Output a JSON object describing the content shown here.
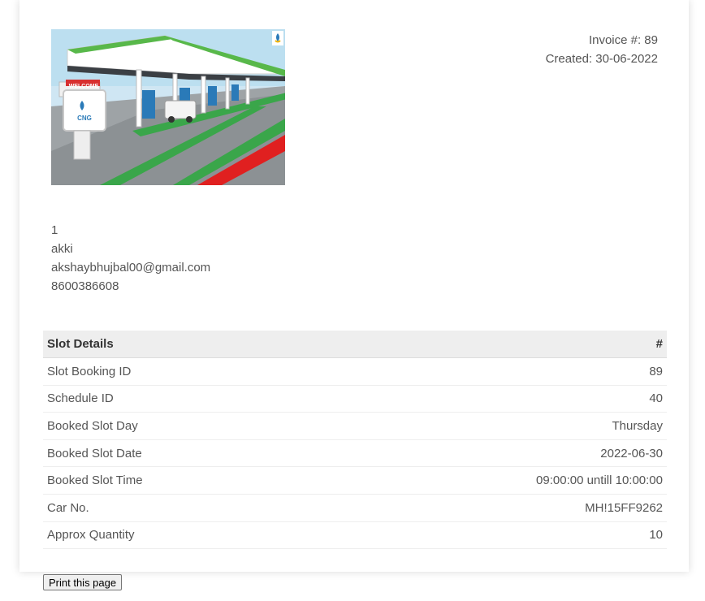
{
  "invoice": {
    "number_label": "Invoice #: 89",
    "created_label": "Created: 30-06-2022"
  },
  "logo": {
    "icon": "cng-station-illustration",
    "sign_text": "CNG",
    "welcome_text": "WELCOME"
  },
  "customer": {
    "id": "1",
    "name": "akki",
    "email": "akshaybhujbal00@gmail.com",
    "phone": "8600386608"
  },
  "table": {
    "header_left": "Slot Details",
    "header_right": "#",
    "rows": [
      {
        "label": "Slot Booking ID",
        "value": "89"
      },
      {
        "label": "Schedule ID",
        "value": "40"
      },
      {
        "label": "Booked Slot Day",
        "value": "Thursday"
      },
      {
        "label": "Booked Slot Date",
        "value": "2022-06-30"
      },
      {
        "label": "Booked Slot Time",
        "value": "09:00:00 untill 10:00:00"
      },
      {
        "label": "Car No.",
        "value": "MH!15FF9262"
      },
      {
        "label": "Approx Quantity",
        "value": "10"
      }
    ]
  },
  "print_button": "Print this page"
}
